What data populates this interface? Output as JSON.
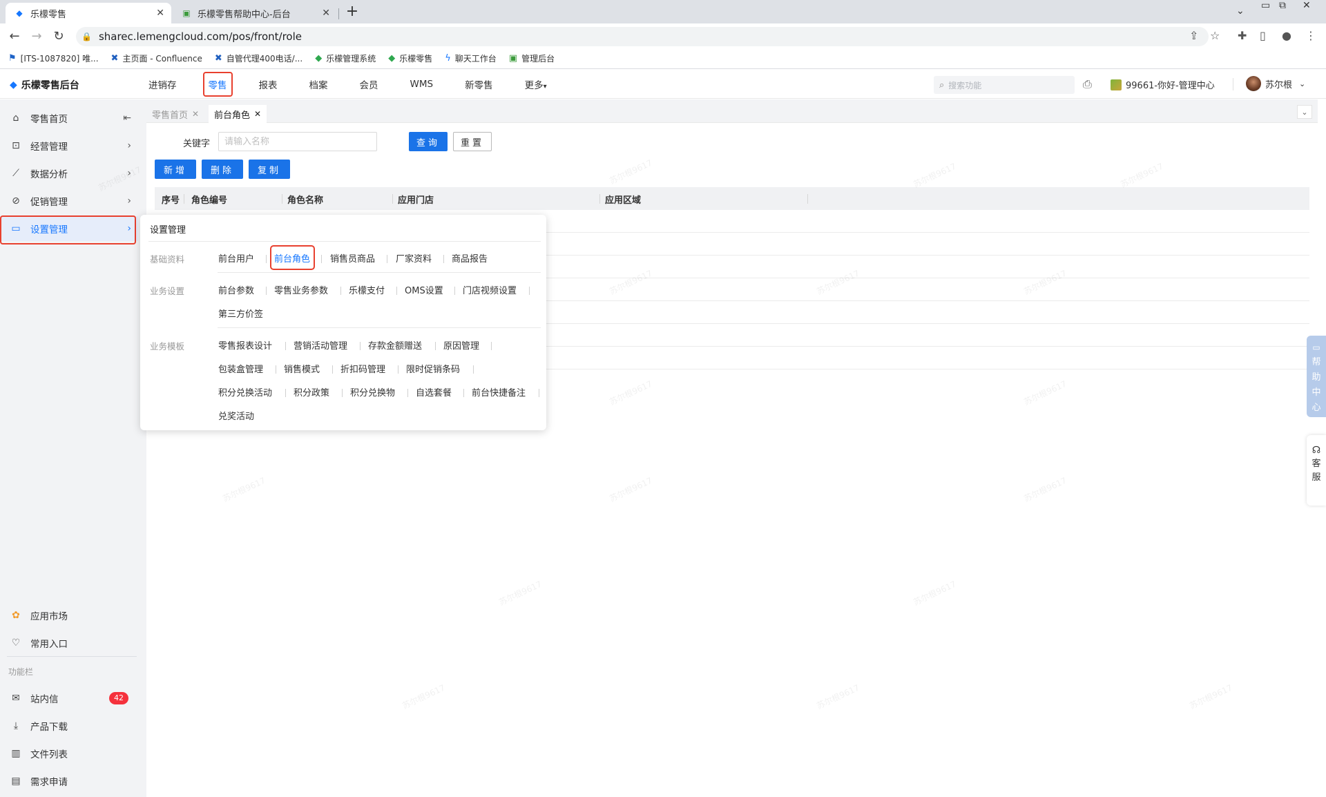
{
  "browser": {
    "tabs": [
      {
        "title": "乐檬零售",
        "active": true
      },
      {
        "title": "乐檬零售帮助中心-后台",
        "active": false
      }
    ],
    "url": "sharec.lemengcloud.com/pos/front/role",
    "bookmarks": [
      "[ITS-1087820] 唯...",
      "主页面 - Confluence",
      "自管代理400电话/...",
      "乐檬管理系统",
      "乐檬零售",
      "聊天工作台",
      "管理后台"
    ]
  },
  "header": {
    "app_name": "乐檬零售后台",
    "nav": [
      "进销存",
      "零售",
      "报表",
      "档案",
      "会员",
      "WMS",
      "新零售",
      "更多"
    ],
    "active_nav": "零售",
    "more_caret": "▾",
    "search_placeholder": "搜索功能",
    "store": "99661-你好-管理中心",
    "user": "苏尔根"
  },
  "sidebar": {
    "items": [
      "零售首页",
      "经营管理",
      "数据分析",
      "促销管理",
      "设置管理"
    ],
    "active": "设置管理",
    "bottom_items": [
      "应用市场",
      "常用入口"
    ],
    "section_title": "功能栏",
    "func_items": [
      "站内信",
      "产品下载",
      "文件列表",
      "需求申请"
    ],
    "unread_count": "42"
  },
  "page_tabs": [
    {
      "label": "零售首页",
      "closable": true,
      "current": false
    },
    {
      "label": "前台角色",
      "closable": true,
      "current": true
    }
  ],
  "filter": {
    "keyword_label": "关键字",
    "keyword_placeholder": "请输入名称",
    "query": "查询",
    "reset": "重置"
  },
  "actions": {
    "add": "新增",
    "delete": "删除",
    "copy": "复制"
  },
  "table": {
    "columns": [
      "序号",
      "角色编号",
      "角色名称",
      "应用门店",
      "应用区域"
    ]
  },
  "dropdown": {
    "title": "设置管理",
    "groups": [
      {
        "category": "基础资料",
        "items": [
          "前台用户",
          "前台角色",
          "销售员商品",
          "厂家资料",
          "商品报告"
        ]
      },
      {
        "category": "业务设置",
        "items": [
          "前台参数",
          "零售业务参数",
          "乐檬支付",
          "OMS设置",
          "门店视频设置",
          "第三方价签"
        ]
      },
      {
        "category": "业务模板",
        "items": [
          "零售报表设计",
          "营销活动管理",
          "存款金额赠送",
          "原因管理",
          "包装盒管理",
          "销售模式",
          "折扣码管理",
          "限时促销条码",
          "积分兑换活动",
          "积分政策",
          "积分兑换物",
          "自选套餐",
          "前台快捷备注",
          "兑奖活动"
        ]
      }
    ],
    "selected": "前台角色"
  },
  "float": {
    "help": [
      "帮",
      "助",
      "中",
      "心"
    ],
    "service": [
      "客",
      "服"
    ]
  },
  "watermark_text": "苏尔根9617"
}
